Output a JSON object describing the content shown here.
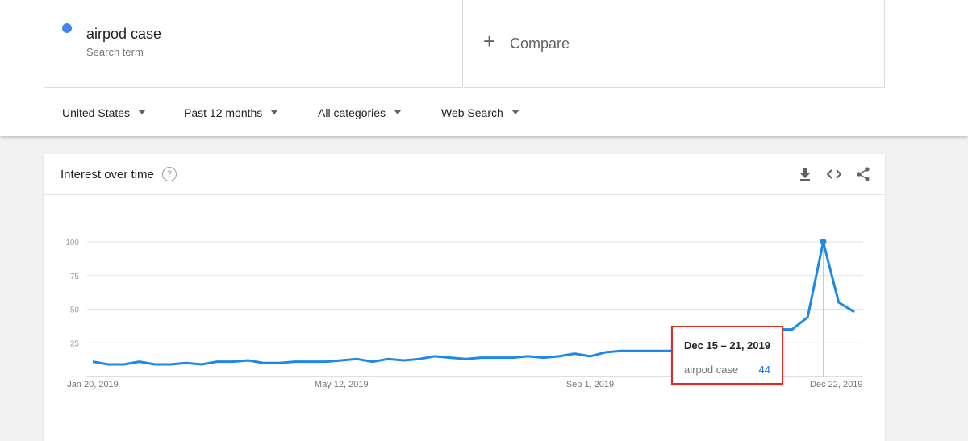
{
  "search_term": {
    "name": "airpod case",
    "subtitle": "Search term",
    "color": "#4285f4"
  },
  "compare": {
    "label": "Compare"
  },
  "filters": [
    {
      "label": "United States"
    },
    {
      "label": "Past 12 months"
    },
    {
      "label": "All categories"
    },
    {
      "label": "Web Search"
    }
  ],
  "panel": {
    "title": "Interest over time",
    "icons": [
      "help-icon",
      "download-icon",
      "embed-code-icon",
      "share-icon"
    ]
  },
  "tooltip": {
    "date": "Dec 15 – 21, 2019",
    "term": "airpod case",
    "value": "44"
  },
  "chart_data": {
    "type": "line",
    "ylim": [
      0,
      100
    ],
    "yticks": [
      25,
      50,
      75,
      100
    ],
    "grid": true,
    "xtick_labels": [
      {
        "index": 0,
        "label": "Jan 20, 2019"
      },
      {
        "index": 16,
        "label": "May 12, 2019"
      },
      {
        "index": 32,
        "label": "Sep 1, 2019"
      },
      {
        "index": 48,
        "label": "Dec 22, 2019"
      }
    ],
    "highlight_index": 47,
    "series": [
      {
        "color": "#1e88e5",
        "values": [
          11,
          9,
          9,
          11,
          9,
          9,
          10,
          9,
          11,
          11,
          12,
          10,
          10,
          11,
          11,
          11,
          12,
          13,
          11,
          13,
          12,
          13,
          15,
          14,
          13,
          14,
          14,
          14,
          15,
          14,
          15,
          17,
          15,
          18,
          19,
          19,
          19,
          19,
          19,
          19,
          21,
          25,
          31,
          37,
          35,
          35,
          44,
          100,
          55,
          48
        ]
      }
    ]
  }
}
